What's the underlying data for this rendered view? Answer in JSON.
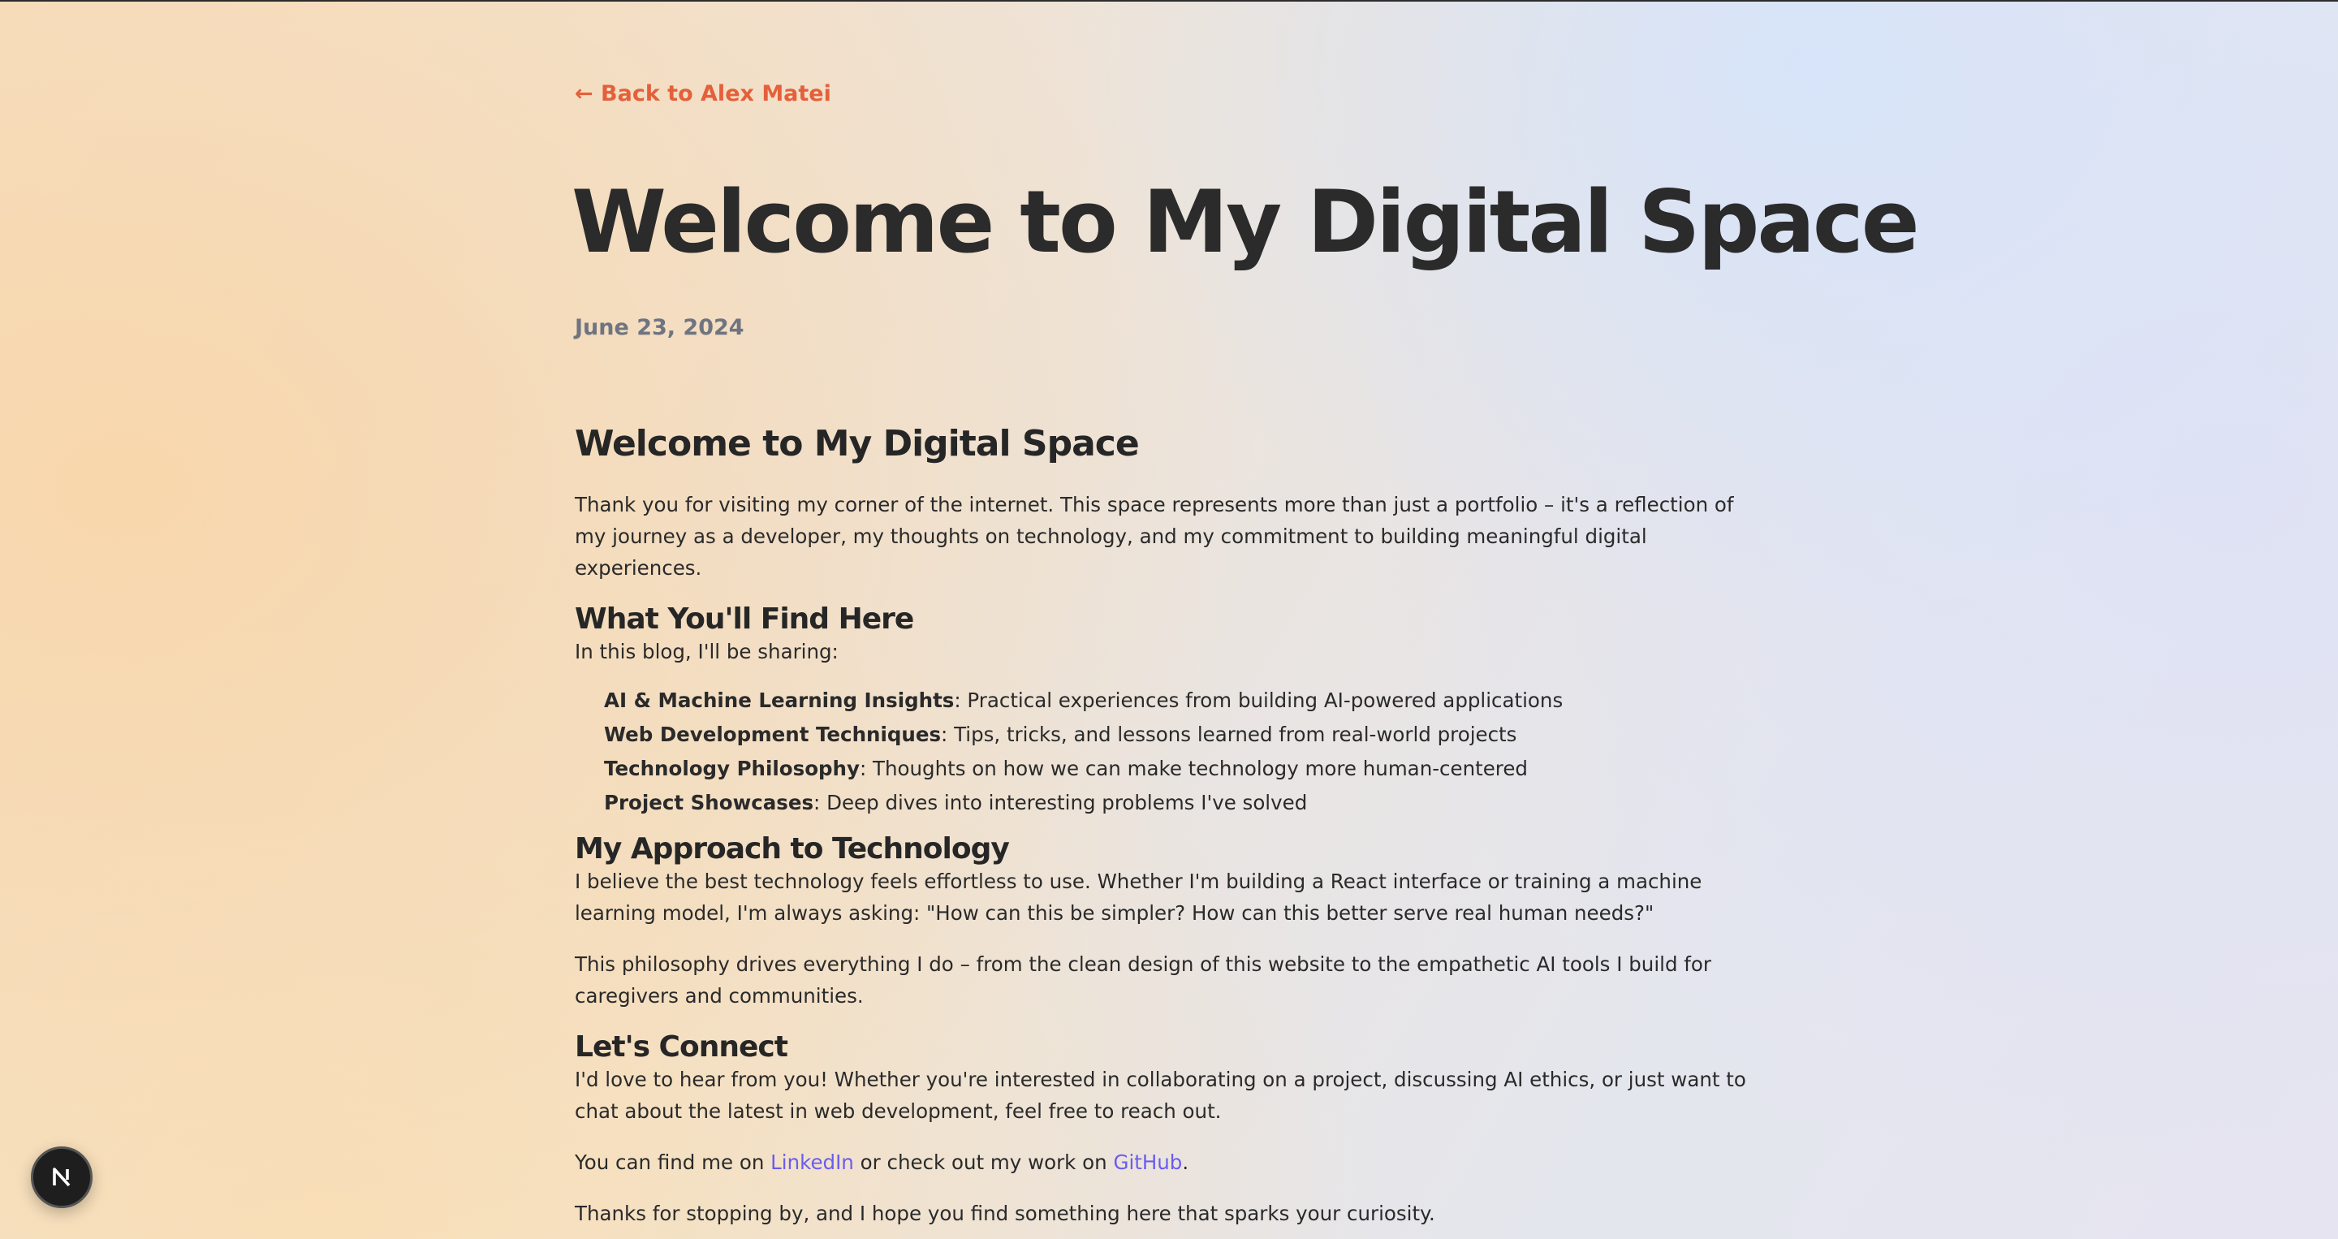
{
  "nav": {
    "back_label": "← Back to Alex Matei"
  },
  "post": {
    "title": "Welcome to My Digital Space",
    "date": "June 23, 2024"
  },
  "article": {
    "heading": "Welcome to My Digital Space",
    "intro": "Thank you for visiting my corner of the internet. This space represents more than just a portfolio – it's a reflection of my journey as a developer, my thoughts on technology, and my commitment to building meaningful digital experiences.",
    "find_heading": "What You'll Find Here",
    "find_intro": "In this blog, I'll be sharing:",
    "bullets": [
      {
        "title": "AI & Machine Learning Insights",
        "text": ": Practical experiences from building AI-powered applications"
      },
      {
        "title": "Web Development Techniques",
        "text": ": Tips, tricks, and lessons learned from real-world projects"
      },
      {
        "title": "Technology Philosophy",
        "text": ": Thoughts on how we can make technology more human-centered"
      },
      {
        "title": "Project Showcases",
        "text": ": Deep dives into interesting problems I've solved"
      }
    ],
    "approach_heading": "My Approach to Technology",
    "approach_p1": "I believe the best technology feels effortless to use. Whether I'm building a React interface or training a machine learning model, I'm always asking: \"How can this be simpler? How can this better serve real human needs?\"",
    "approach_p2": "This philosophy drives everything I do – from the clean design of this website to the empathetic AI tools I build for caregivers and communities.",
    "connect_heading": "Let's Connect",
    "connect_p1": "I'd love to hear from you! Whether you're interested in collaborating on a project, discussing AI ethics, or just want to chat about the latest in web development, feel free to reach out.",
    "connect_p2_before": "You can find me on ",
    "linkedin_label": "LinkedIn",
    "connect_p2_middle": " or check out my work on ",
    "github_label": "GitHub",
    "connect_p2_after": ".",
    "closing": "Thanks for stopping by, and I hope you find something here that sparks your curiosity."
  },
  "badge": {
    "icon": "nextjs-logo-icon"
  },
  "colors": {
    "accent": "#e4603a",
    "link": "#6a5cf0",
    "date": "#6f7480"
  }
}
